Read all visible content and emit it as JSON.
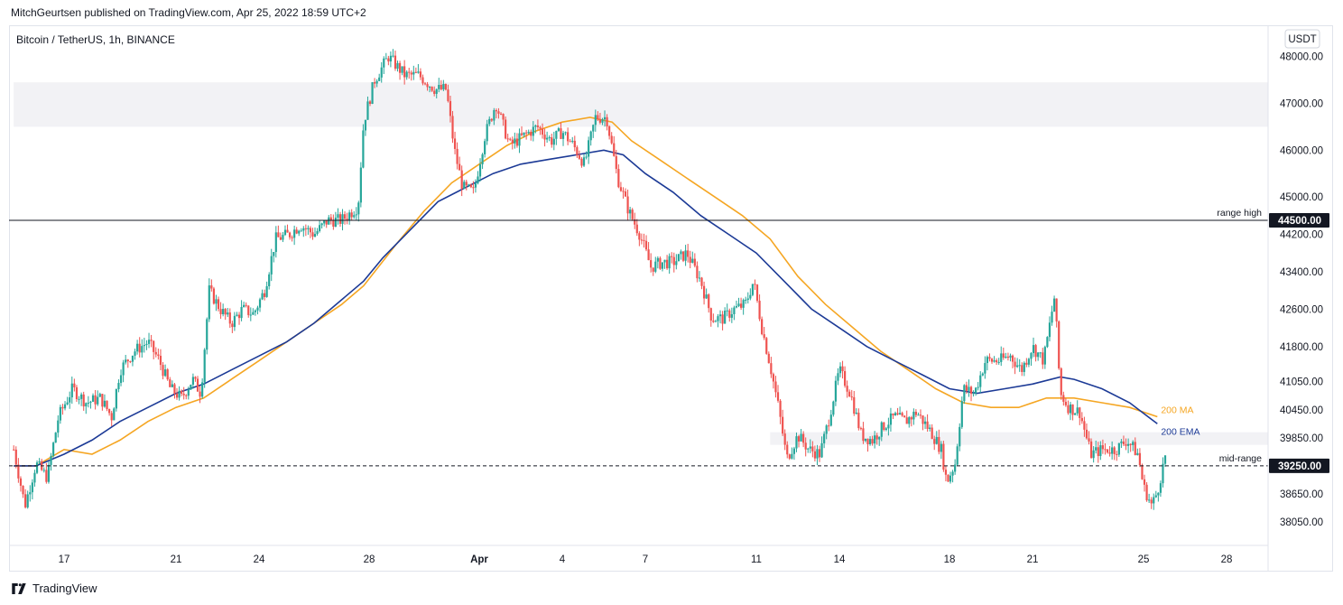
{
  "header": {
    "published": "MitchGeurtsen published on TradingView.com, Apr 25, 2022 18:59 UTC+2"
  },
  "footer": {
    "brand": "TradingView"
  },
  "chart_data": {
    "type": "candlestick",
    "title": "Bitcoin / TetherUS, 1h, BINANCE",
    "currency_label": "USDT",
    "ylim": [
      37550,
      48650
    ],
    "y_ticks": [
      {
        "value": 48000,
        "label": "48000.00"
      },
      {
        "value": 47000,
        "label": "47000.00"
      },
      {
        "value": 46000,
        "label": "46000.00"
      },
      {
        "value": 45000,
        "label": "45000.00"
      },
      {
        "value": 44200,
        "label": "44200.00"
      },
      {
        "value": 43400,
        "label": "43400.00"
      },
      {
        "value": 42600,
        "label": "42600.00"
      },
      {
        "value": 41800,
        "label": "41800.00"
      },
      {
        "value": 41050,
        "label": "41050.00"
      },
      {
        "value": 40450,
        "label": "40450.00"
      },
      {
        "value": 39850,
        "label": "39850.00"
      },
      {
        "value": 38650,
        "label": "38650.00"
      },
      {
        "value": 38050,
        "label": "38050.00"
      }
    ],
    "x_ticks": [
      {
        "day": 17,
        "label": "17"
      },
      {
        "day": 21,
        "label": "21"
      },
      {
        "day": 24,
        "label": "24"
      },
      {
        "day": 28,
        "label": "28"
      },
      {
        "day": 32,
        "label": "Apr"
      },
      {
        "day": 35,
        "label": "4"
      },
      {
        "day": 38,
        "label": "7"
      },
      {
        "day": 42,
        "label": "11"
      },
      {
        "day": 45,
        "label": "14"
      },
      {
        "day": 49,
        "label": "18"
      },
      {
        "day": 52,
        "label": "21"
      },
      {
        "day": 56,
        "label": "25"
      },
      {
        "day": 59,
        "label": "28"
      }
    ],
    "xlim_days": [
      15.2,
      60.5
    ],
    "horizontal_lines": [
      {
        "name": "range high",
        "label": "range high",
        "value": 44500,
        "value_label": "44500.00",
        "style": "solid"
      },
      {
        "name": "mid-range",
        "label": "mid-range",
        "value": 39250,
        "value_label": "39250.00",
        "style": "dashed"
      }
    ],
    "zones": [
      {
        "name": "top-zone",
        "from_day": 15.2,
        "to_day": 60.5,
        "low": 46500,
        "high": 47450
      },
      {
        "name": "mid-zone",
        "from_day": 42.5,
        "to_day": 60.5,
        "low": 39700,
        "high": 39970
      }
    ],
    "price_path": [
      [
        15.2,
        39600
      ],
      [
        15.6,
        38400
      ],
      [
        16.0,
        39300
      ],
      [
        16.4,
        39000
      ],
      [
        16.8,
        40300
      ],
      [
        17.3,
        40900
      ],
      [
        17.8,
        40600
      ],
      [
        18.3,
        40700
      ],
      [
        18.7,
        40300
      ],
      [
        19.0,
        41300
      ],
      [
        19.5,
        41700
      ],
      [
        20.0,
        41900
      ],
      [
        20.4,
        41500
      ],
      [
        20.8,
        40900
      ],
      [
        21.2,
        40700
      ],
      [
        21.6,
        41100
      ],
      [
        21.9,
        40800
      ],
      [
        22.2,
        43000
      ],
      [
        22.6,
        42600
      ],
      [
        23.0,
        42300
      ],
      [
        23.4,
        42600
      ],
      [
        23.8,
        42500
      ],
      [
        24.2,
        43000
      ],
      [
        24.6,
        44100
      ],
      [
        25.1,
        44200
      ],
      [
        25.5,
        44400
      ],
      [
        26.0,
        44200
      ],
      [
        26.5,
        44500
      ],
      [
        27.0,
        44500
      ],
      [
        27.6,
        44800
      ],
      [
        27.8,
        46600
      ],
      [
        28.2,
        47500
      ],
      [
        28.7,
        48000
      ],
      [
        29.3,
        47600
      ],
      [
        29.8,
        47600
      ],
      [
        30.4,
        47300
      ],
      [
        30.8,
        47300
      ],
      [
        31.1,
        46000
      ],
      [
        31.4,
        45200
      ],
      [
        31.8,
        45100
      ],
      [
        32.2,
        46300
      ],
      [
        32.6,
        47000
      ],
      [
        33.1,
        46100
      ],
      [
        33.6,
        46300
      ],
      [
        34.1,
        46500
      ],
      [
        34.6,
        46200
      ],
      [
        35.0,
        46400
      ],
      [
        35.4,
        46100
      ],
      [
        35.8,
        45700
      ],
      [
        36.2,
        46700
      ],
      [
        36.6,
        46700
      ],
      [
        37.0,
        45400
      ],
      [
        37.4,
        44700
      ],
      [
        37.8,
        44200
      ],
      [
        38.2,
        43500
      ],
      [
        38.6,
        43600
      ],
      [
        39.0,
        43600
      ],
      [
        39.5,
        43800
      ],
      [
        40.0,
        43200
      ],
      [
        40.4,
        42400
      ],
      [
        40.8,
        42400
      ],
      [
        41.2,
        42600
      ],
      [
        41.6,
        42700
      ],
      [
        41.9,
        43200
      ],
      [
        42.2,
        42200
      ],
      [
        42.5,
        41400
      ],
      [
        42.8,
        40500
      ],
      [
        43.1,
        39400
      ],
      [
        43.5,
        39900
      ],
      [
        43.9,
        39600
      ],
      [
        44.3,
        39500
      ],
      [
        44.6,
        40200
      ],
      [
        45.0,
        41300
      ],
      [
        45.4,
        40800
      ],
      [
        45.8,
        39900
      ],
      [
        46.2,
        39800
      ],
      [
        46.6,
        40100
      ],
      [
        47.0,
        40300
      ],
      [
        47.4,
        40200
      ],
      [
        47.8,
        40400
      ],
      [
        48.3,
        40000
      ],
      [
        48.7,
        39600
      ],
      [
        48.9,
        38900
      ],
      [
        49.2,
        39300
      ],
      [
        49.5,
        40900
      ],
      [
        49.9,
        40800
      ],
      [
        50.3,
        41500
      ],
      [
        50.8,
        41500
      ],
      [
        51.2,
        41600
      ],
      [
        51.6,
        41300
      ],
      [
        52.0,
        41800
      ],
      [
        52.4,
        41500
      ],
      [
        52.8,
        42900
      ],
      [
        53.0,
        40800
      ],
      [
        53.3,
        40500
      ],
      [
        53.7,
        40400
      ],
      [
        54.1,
        39500
      ],
      [
        54.5,
        39600
      ],
      [
        55.0,
        39600
      ],
      [
        55.4,
        39800
      ],
      [
        55.8,
        39500
      ],
      [
        56.0,
        38800
      ],
      [
        56.3,
        38400
      ],
      [
        56.5,
        38700
      ],
      [
        56.8,
        39500
      ]
    ],
    "series": [
      {
        "name": "200 MA",
        "label": "200 MA",
        "color": "#f5a623",
        "points": [
          [
            15.2,
            39250
          ],
          [
            16.0,
            39250
          ],
          [
            17.0,
            39600
          ],
          [
            18.0,
            39500
          ],
          [
            19.0,
            39800
          ],
          [
            20.0,
            40200
          ],
          [
            21.0,
            40500
          ],
          [
            22.0,
            40700
          ],
          [
            23.0,
            41100
          ],
          [
            24.0,
            41500
          ],
          [
            25.0,
            41900
          ],
          [
            26.0,
            42300
          ],
          [
            27.0,
            42700
          ],
          [
            27.8,
            43100
          ],
          [
            29.0,
            44000
          ],
          [
            30.0,
            44700
          ],
          [
            31.0,
            45300
          ],
          [
            32.0,
            45700
          ],
          [
            33.0,
            46100
          ],
          [
            34.0,
            46400
          ],
          [
            35.0,
            46600
          ],
          [
            36.0,
            46700
          ],
          [
            36.8,
            46600
          ],
          [
            37.5,
            46200
          ],
          [
            38.5,
            45800
          ],
          [
            39.5,
            45400
          ],
          [
            40.5,
            45000
          ],
          [
            41.5,
            44600
          ],
          [
            42.5,
            44100
          ],
          [
            43.5,
            43300
          ],
          [
            44.5,
            42700
          ],
          [
            45.5,
            42200
          ],
          [
            46.5,
            41700
          ],
          [
            47.5,
            41300
          ],
          [
            48.5,
            40900
          ],
          [
            49.5,
            40600
          ],
          [
            50.5,
            40500
          ],
          [
            51.5,
            40500
          ],
          [
            52.5,
            40700
          ],
          [
            53.5,
            40700
          ],
          [
            54.5,
            40600
          ],
          [
            55.5,
            40500
          ],
          [
            56.5,
            40300
          ]
        ]
      },
      {
        "name": "200 EMA",
        "label": "200 EMA",
        "color": "#1c3a96",
        "points": [
          [
            15.2,
            39250
          ],
          [
            16.0,
            39250
          ],
          [
            17.0,
            39500
          ],
          [
            18.0,
            39800
          ],
          [
            19.0,
            40200
          ],
          [
            20.0,
            40500
          ],
          [
            21.0,
            40800
          ],
          [
            22.0,
            41000
          ],
          [
            23.0,
            41300
          ],
          [
            24.0,
            41600
          ],
          [
            25.0,
            41900
          ],
          [
            26.0,
            42300
          ],
          [
            27.0,
            42800
          ],
          [
            27.8,
            43200
          ],
          [
            28.5,
            43700
          ],
          [
            29.5,
            44300
          ],
          [
            30.5,
            44900
          ],
          [
            31.5,
            45200
          ],
          [
            32.5,
            45500
          ],
          [
            33.5,
            45700
          ],
          [
            34.5,
            45800
          ],
          [
            35.5,
            45900
          ],
          [
            36.5,
            46000
          ],
          [
            37.2,
            45900
          ],
          [
            38.0,
            45500
          ],
          [
            39.0,
            45100
          ],
          [
            40.0,
            44600
          ],
          [
            41.0,
            44200
          ],
          [
            42.0,
            43800
          ],
          [
            43.0,
            43200
          ],
          [
            44.0,
            42600
          ],
          [
            45.0,
            42200
          ],
          [
            46.0,
            41800
          ],
          [
            47.0,
            41500
          ],
          [
            48.0,
            41200
          ],
          [
            49.0,
            40900
          ],
          [
            50.0,
            40800
          ],
          [
            51.0,
            40900
          ],
          [
            52.0,
            41000
          ],
          [
            53.0,
            41150
          ],
          [
            53.5,
            41100
          ],
          [
            54.5,
            40900
          ],
          [
            55.5,
            40600
          ],
          [
            56.5,
            40150
          ]
        ]
      }
    ],
    "colors": {
      "up": "#26a69a",
      "down": "#ef5350",
      "axis_text": "#131722",
      "grid_border": "#e0e3eb"
    }
  }
}
